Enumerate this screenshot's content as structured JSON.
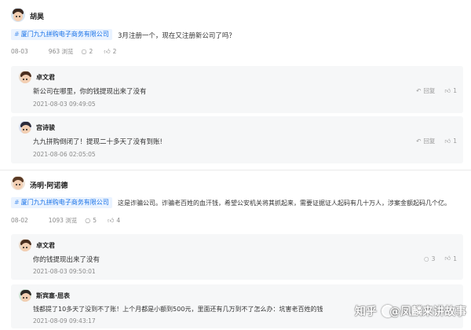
{
  "post1": {
    "author": "胡昊",
    "company_tag": "厦门九九拼购电子商务有限公司",
    "text": "3月注册一个，现在又注册新公司了吗？",
    "date": "08-03",
    "views": "963 浏览",
    "comments": "2",
    "likes": "2",
    "replies": [
      {
        "author": "卓文君",
        "text": "新公司在哪里，你的钱提现出来了没有",
        "time": "2021-08-03 09:49:05",
        "reply_label": "回复",
        "likes": "1"
      },
      {
        "author": "宫诗骏",
        "text": "九九拼购倒闭了！提现二十多天了没有到账!",
        "time": "2021-08-06 02:05:05",
        "reply_label": "回复",
        "likes": "1"
      }
    ]
  },
  "post2": {
    "author": "汤明·阿诺德",
    "company_tag": "厦门九九拼购电子商务有限公司",
    "text": "这是诈骗公司。诈骗老百姓的血汗钱，希望公安机关将其抓起来，需要证据证人起码有几十万人，涉案金额起码几个亿。",
    "date": "08-02",
    "views": "1093 浏览",
    "comments": "5",
    "likes": "4",
    "replies": [
      {
        "author": "卓文君",
        "text": "你的钱提现出来了没有",
        "time": "2021-08-03 09:50:01",
        "reply_label": "3",
        "likes": "1"
      },
      {
        "author": "斯宾塞·屈表",
        "text": "钱都提了10多天了没到不了账！上个月都是小额到500元，里面还有几万到不了怎么办：坑害老百姓的钱",
        "time": "2021-08-09 09:43:17",
        "reply_label": "",
        "likes": ""
      }
    ]
  },
  "watermark": {
    "site": "知乎",
    "user": "@凤麟来讲故事"
  },
  "colors": {
    "tag_bg": "#eaf3ff",
    "tag_text": "#1a73e8",
    "reply_bg": "#f6f7f8"
  }
}
